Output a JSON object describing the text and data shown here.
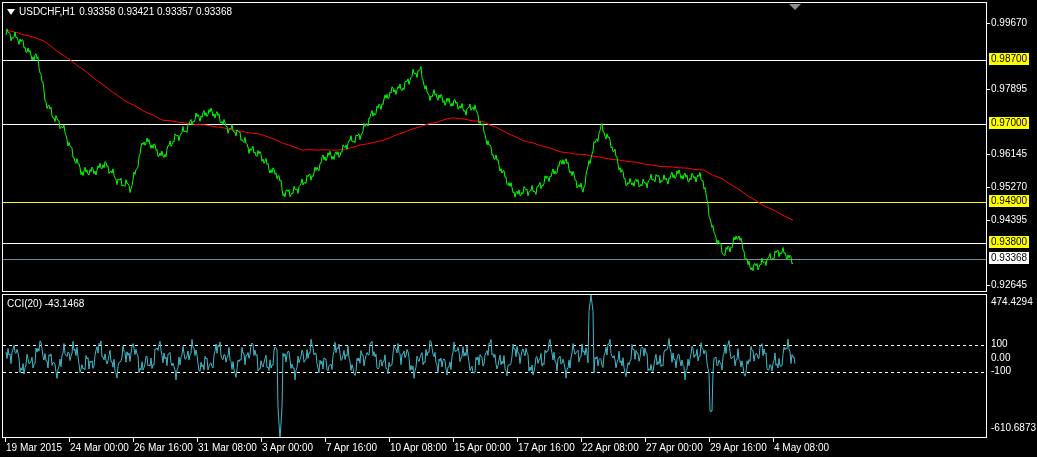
{
  "chart": {
    "symbol": "USDCHF,H1",
    "ohlc": "0.93358 0.93421 0.93357 0.93368"
  },
  "price_axis": [
    "0.99670",
    "0.97895",
    "0.96145",
    "0.95270",
    "0.94395",
    "0.92645"
  ],
  "price_lines": [
    {
      "price": "0.98700",
      "kind": "level",
      "color": "#ffffff"
    },
    {
      "price": "0.97000",
      "kind": "level",
      "color": "#ffffff"
    },
    {
      "price": "0.94900",
      "kind": "level",
      "color": "#ffff00"
    },
    {
      "price": "0.93800",
      "kind": "level",
      "color": "#ffffff"
    },
    {
      "price": "0.93368",
      "kind": "bid",
      "color": "#778899"
    }
  ],
  "indicator": {
    "title": "CCI(20) -43.1468",
    "axis": [
      "474.4294",
      "100",
      "0.00",
      "-100",
      "-610.6873"
    ]
  },
  "time_axis": [
    "19 Mar 2015",
    "24 Mar 00:00",
    "26 Mar 16:00",
    "31 Mar 08:00",
    "3 Apr 00:00",
    "7 Apr 16:00",
    "10 Apr 08:00",
    "15 Apr 00:00",
    "17 Apr 16:00",
    "22 Apr 08:00",
    "27 Apr 00:00",
    "29 Apr 16:00",
    "4 May 08:00"
  ]
}
